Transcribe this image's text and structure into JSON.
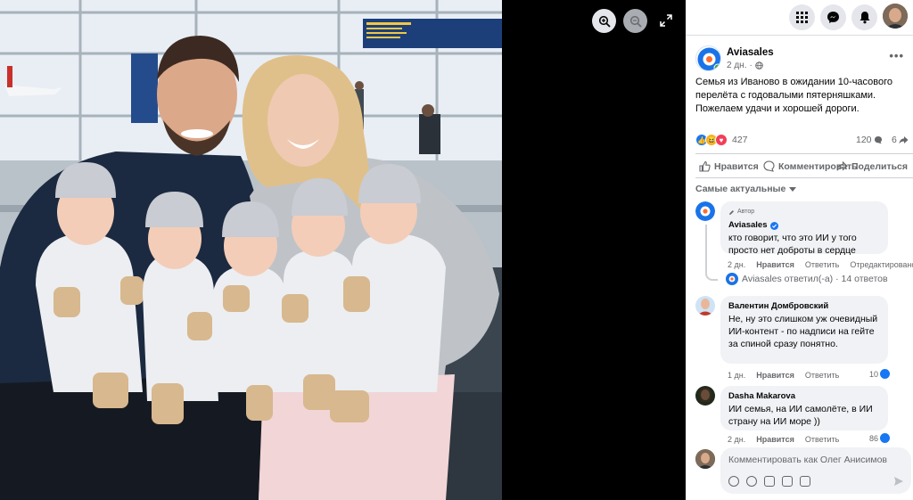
{
  "viewer": {
    "zoom_in_icon": "magnifier-plus-icon",
    "zoom_out_icon": "magnifier-minus-icon",
    "expand_icon": "expand-arrows-icon"
  },
  "topbar": {
    "menu_icon": "grid-menu-icon",
    "messenger_icon": "messenger-icon",
    "notifications_icon": "bell-icon"
  },
  "post": {
    "page_name": "Aviasales",
    "time": "2 дн.",
    "privacy_icon": "globe-icon",
    "text": "Семья из Иваново в ожидании 10-часового перелёта с годовалыми пятерняшками. Пожелаем удачи и хорошей дороги.",
    "reaction_count": "427",
    "comment_count": "120",
    "share_count": "6"
  },
  "actions": {
    "like": "Нравится",
    "comment": "Комментировать",
    "share": "Поделиться"
  },
  "sort_label": "Самые актуальные",
  "comments": [
    {
      "badge": "Автор",
      "author": "Aviasales",
      "text": "кто говорит, что это ИИ у того просто нет доброты в сердце",
      "time": "2 дн.",
      "like": "Нравится",
      "reply": "Ответить",
      "edit": "Отредактировано"
    },
    {
      "author": "Валентин Домбровский",
      "text": "Не, ну это слишком уж очевидный ИИ-контент - по надписи на гейте за спиной сразу понятно.",
      "time": "1 дн.",
      "like": "Нравится",
      "reply": "Ответить",
      "likes": "10"
    },
    {
      "author": "Dasha Makarova",
      "text": "ИИ семья, на ИИ самолёте, в ИИ страну на ИИ море ))",
      "time": "2 дн.",
      "like": "Нравится",
      "reply": "Ответить",
      "likes": "86"
    }
  ],
  "replies_label": "Aviasales ответил(-а) · 14 ответов",
  "composer": {
    "placeholder": "Комментировать как Олег Анисимов"
  },
  "colors": {
    "accent": "#1877f2",
    "panel_bg": "#ffffff",
    "bubble_bg": "#f0f2f5",
    "secondary_text": "#65676b"
  }
}
